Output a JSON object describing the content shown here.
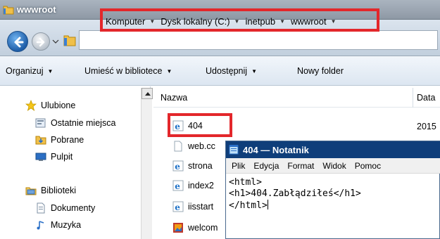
{
  "window": {
    "title": "wwwroot"
  },
  "address": {
    "crumbs": [
      "Komputer",
      "Dysk lokalny (C:)",
      "inetpub",
      "wwwroot"
    ],
    "highlight_color": "#e3272b"
  },
  "toolbar": {
    "organize": "Organizuj",
    "library": "Umieść w bibliotece",
    "share": "Udostępnij",
    "new_folder": "Nowy folder"
  },
  "sidebar": {
    "favorites": "Ulubione",
    "recent": "Ostatnie miejsca",
    "downloads": "Pobrane",
    "desktop": "Pulpit",
    "libraries": "Biblioteki",
    "documents": "Dokumenty",
    "music": "Muzyka"
  },
  "columns": {
    "name": "Nazwa",
    "date": "Data"
  },
  "files": [
    {
      "name": "404",
      "date": "2015",
      "icon": "ie-file-icon"
    },
    {
      "name": "web.cc",
      "date": "",
      "icon": "blank-file-icon"
    },
    {
      "name": "strona",
      "date": "",
      "icon": "ie-file-icon"
    },
    {
      "name": "index2",
      "date": "",
      "icon": "ie-file-icon"
    },
    {
      "name": "iisstart",
      "date": "",
      "icon": "ie-file-icon"
    },
    {
      "name": "welcom",
      "date": "",
      "icon": "image-file-icon"
    }
  ],
  "notepad": {
    "title": "404 — Notatnik",
    "menu": [
      "Plik",
      "Edycja",
      "Format",
      "Widok",
      "Pomoc"
    ],
    "lines": [
      "<html>",
      "<h1>404.Zabłądziłeś</h1>",
      "</html>"
    ]
  }
}
